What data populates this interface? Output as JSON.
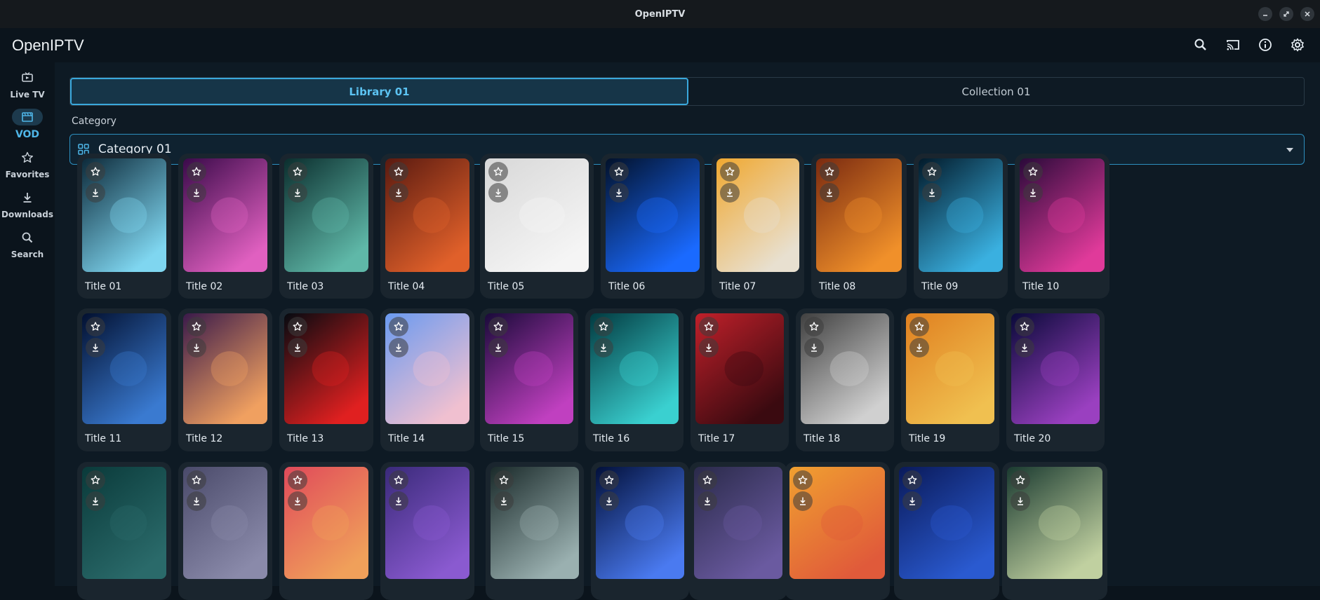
{
  "window": {
    "title": "OpenIPTV"
  },
  "app": {
    "name": "OpenIPTV"
  },
  "nav": [
    {
      "label": "Live TV",
      "icon": "tv-icon",
      "active": false
    },
    {
      "label": "VOD",
      "icon": "film-icon",
      "active": true
    },
    {
      "label": "Favorites",
      "icon": "star-icon",
      "active": false
    },
    {
      "label": "Downloads",
      "icon": "download-icon",
      "active": false
    },
    {
      "label": "Search",
      "icon": "search-icon",
      "active": false
    }
  ],
  "tabs": [
    {
      "label": "Library 01",
      "active": true
    },
    {
      "label": "Collection 01",
      "active": false
    }
  ],
  "category": {
    "label": "Category",
    "selected": "Category 01"
  },
  "items": [
    {
      "title": "Title 01",
      "art": [
        "#0d2a3a",
        "#7fd6f0"
      ]
    },
    {
      "title": "Title 02",
      "art": [
        "#3a0a4a",
        "#e060c0"
      ]
    },
    {
      "title": "Title 03",
      "art": [
        "#0b2e2e",
        "#5fb8a8"
      ]
    },
    {
      "title": "Title 04",
      "art": [
        "#5a1a10",
        "#e0602a"
      ]
    },
    {
      "title": "Title 05",
      "art": [
        "#d8d8d8",
        "#f5f5f5"
      ]
    },
    {
      "title": "Title 06",
      "art": [
        "#02112a",
        "#1a6aff"
      ]
    },
    {
      "title": "Title 07",
      "art": [
        "#f0a830",
        "#e8e0d0"
      ]
    },
    {
      "title": "Title 08",
      "art": [
        "#7a2a10",
        "#f0902a"
      ]
    },
    {
      "title": "Title 09",
      "art": [
        "#021a2a",
        "#3ab0e0"
      ]
    },
    {
      "title": "Title 10",
      "art": [
        "#2a0a3a",
        "#e03a9a"
      ]
    },
    {
      "title": "Title 11",
      "art": [
        "#021030",
        "#3a7ad0"
      ]
    },
    {
      "title": "Title 12",
      "art": [
        "#3a1a4a",
        "#f0a060"
      ]
    },
    {
      "title": "Title 13",
      "art": [
        "#050a10",
        "#e02020"
      ]
    },
    {
      "title": "Title 14",
      "art": [
        "#6a9af0",
        "#f0c0d0"
      ]
    },
    {
      "title": "Title 15",
      "art": [
        "#1a0a3a",
        "#c040c0"
      ]
    },
    {
      "title": "Title 16",
      "art": [
        "#023a40",
        "#3ad0d0"
      ]
    },
    {
      "title": "Title 17",
      "art": [
        "#c0202a",
        "#3a0a10"
      ]
    },
    {
      "title": "Title 18",
      "art": [
        "#404040",
        "#d0d0d0"
      ]
    },
    {
      "title": "Title 19",
      "art": [
        "#e08020",
        "#f0c050"
      ]
    },
    {
      "title": "Title 20",
      "art": [
        "#0a0a3a",
        "#9a40c0"
      ]
    },
    {
      "title": "",
      "art": [
        "#0a3a3a",
        "#2a6a6a"
      ]
    },
    {
      "title": "",
      "art": [
        "#4a4a6a",
        "#8a8aaa"
      ]
    },
    {
      "title": "",
      "art": [
        "#e04a5a",
        "#f0a05a"
      ]
    },
    {
      "title": "",
      "art": [
        "#3a2a7a",
        "#8a5ad0"
      ]
    },
    {
      "title": "",
      "art": [
        "#1a2a2a",
        "#9ab0b0"
      ]
    },
    {
      "title": "",
      "art": [
        "#02103a",
        "#4a7af0"
      ]
    },
    {
      "title": "",
      "art": [
        "#2a2a4a",
        "#6a5aa0"
      ]
    },
    {
      "title": "",
      "art": [
        "#f0a030",
        "#e05a3a"
      ]
    },
    {
      "title": "",
      "art": [
        "#0a1a5a",
        "#2a5ad0"
      ]
    },
    {
      "title": "",
      "art": [
        "#1a3a30",
        "#c0d0a0"
      ]
    }
  ]
}
